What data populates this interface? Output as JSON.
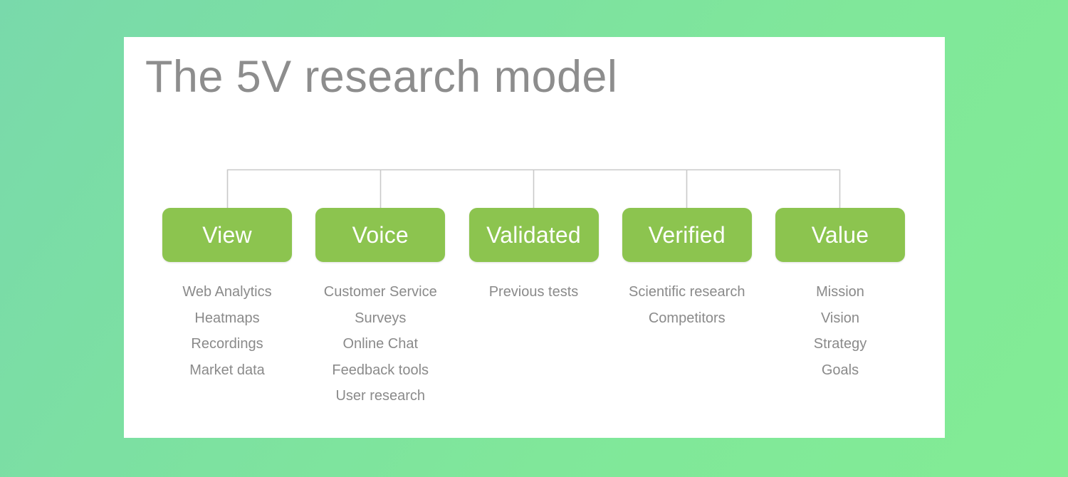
{
  "background": {
    "gradient_from": "#79d9ab",
    "gradient_to": "#82ec95"
  },
  "card": {
    "background": "#ffffff"
  },
  "title": "The 5V research model",
  "theme": {
    "node_fill": "#8cc44f",
    "node_text": "#ffffff",
    "body_text": "#8a8a8a",
    "title_text": "#8d8d8d",
    "connector_line": "#c9c9c9"
  },
  "diagram": {
    "type": "hierarchy",
    "connector_style": "orthogonal-bus",
    "columns": [
      {
        "id": "view",
        "label": "View",
        "items": [
          "Web Analytics",
          "Heatmaps",
          "Recordings",
          "Market data"
        ]
      },
      {
        "id": "voice",
        "label": "Voice",
        "items": [
          "Customer Service",
          "Surveys",
          "Online Chat",
          "Feedback tools",
          "User research"
        ]
      },
      {
        "id": "validated",
        "label": "Validated",
        "items": [
          "Previous tests"
        ]
      },
      {
        "id": "verified",
        "label": "Verified",
        "items": [
          "Scientific research",
          "Competitors"
        ]
      },
      {
        "id": "value",
        "label": "Value",
        "items": [
          "Mission",
          "Vision",
          "Strategy",
          "Goals"
        ]
      }
    ]
  }
}
